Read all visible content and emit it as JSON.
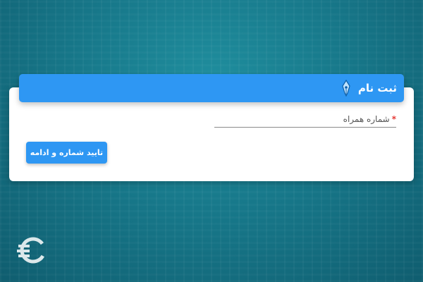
{
  "form": {
    "title": "ثبت نام",
    "header_icon": "pen-nib-icon",
    "phone_field": {
      "label": "شماره همراه",
      "required_mark": "*",
      "value": "",
      "placeholder": ""
    },
    "submit_label": "تایید شماره و ادامه"
  },
  "watermark": {
    "icon": "sputnik-logo-icon"
  },
  "colors": {
    "accent": "#2e97f3",
    "required": "#e53935",
    "background": "#17788a"
  }
}
